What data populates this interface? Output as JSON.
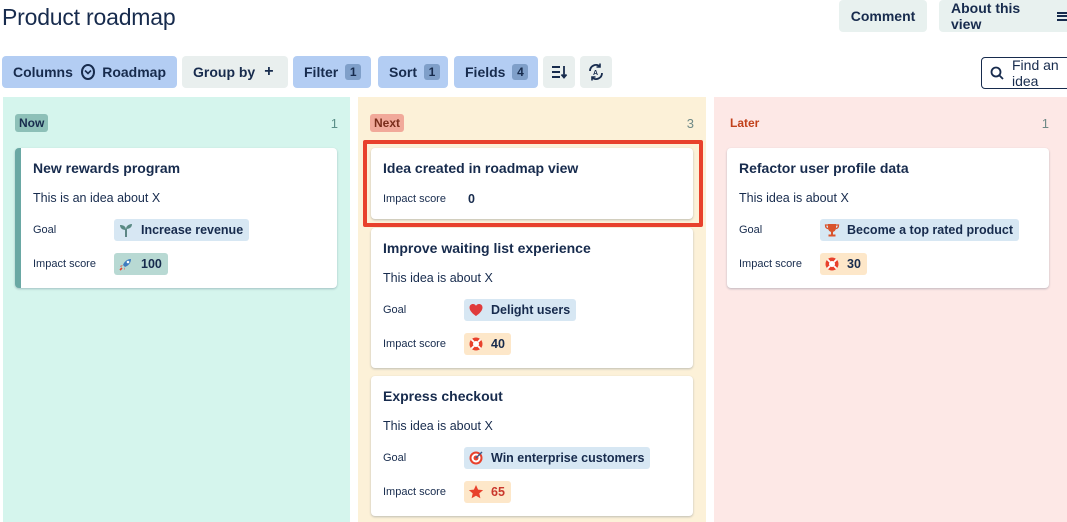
{
  "header": {
    "title": "Product roadmap",
    "comment_label": "Comment",
    "about_label": "About this view"
  },
  "toolbar": {
    "columns_label": "Columns",
    "columns_value": "Roadmap",
    "group_by_label": "Group by",
    "filter_label": "Filter",
    "filter_count": "1",
    "sort_label": "Sort",
    "sort_count": "1",
    "fields_label": "Fields",
    "fields_count": "4"
  },
  "search": {
    "placeholder": "Find an idea"
  },
  "columns": [
    {
      "label": "Now",
      "count": "1",
      "cards": [
        {
          "title": "New rewards program",
          "description": "This is an idea about X",
          "goal_label": "Goal",
          "goal": "Increase revenue",
          "goal_icon": "sprout-icon",
          "impact_label": "Impact score",
          "impact": "100",
          "impact_icon": "rocket-icon"
        }
      ]
    },
    {
      "label": "Next",
      "count": "3",
      "cards": [
        {
          "title": "Idea created in roadmap view",
          "impact_label": "Impact score",
          "impact": "0"
        },
        {
          "title": "Improve waiting list experience",
          "description": "This idea is about X",
          "goal_label": "Goal",
          "goal": "Delight users",
          "goal_icon": "heart-icon",
          "impact_label": "Impact score",
          "impact": "40",
          "impact_icon": "lifebuoy-icon"
        },
        {
          "title": "Express checkout",
          "description": "This idea is about X",
          "goal_label": "Goal",
          "goal": "Win enterprise customers",
          "goal_icon": "target-icon",
          "impact_label": "Impact score",
          "impact": "65",
          "impact_icon": "star-icon"
        }
      ]
    },
    {
      "label": "Later",
      "count": "1",
      "cards": [
        {
          "title": "Refactor user profile data",
          "description": "This idea is about X",
          "goal_label": "Goal",
          "goal": "Become a top rated product",
          "goal_icon": "trophy-icon",
          "impact_label": "Impact score",
          "impact": "30",
          "impact_icon": "lifebuoy-icon"
        }
      ]
    }
  ],
  "colors": {
    "now_bg": "#d5f5ed",
    "next_bg": "#fcf1d8",
    "later_bg": "#fde8e6",
    "highlight": "#e8412c",
    "filter_blue": "#b3cdf3"
  }
}
